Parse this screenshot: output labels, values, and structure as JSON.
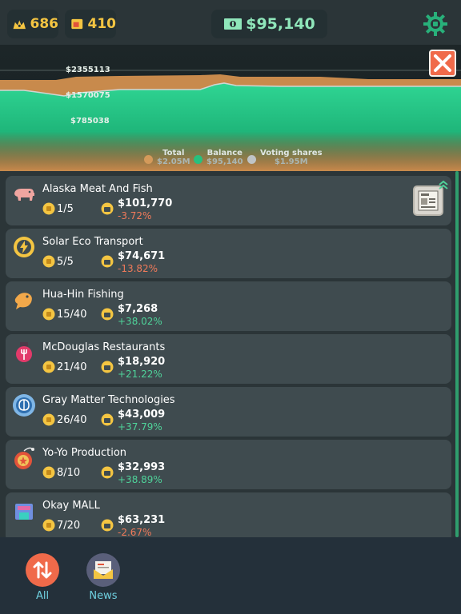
{
  "topbar": {
    "stat1": "686",
    "stat2": "410",
    "balance": "$95,140"
  },
  "chart_data": {
    "type": "area",
    "y_labels": [
      "$2355113",
      "$1570075",
      "$785038"
    ],
    "series": [
      {
        "name": "Total",
        "value": "$2.05M",
        "color": "#d49a5a"
      },
      {
        "name": "Balance",
        "value": "$95,140",
        "color": "#27c07e"
      },
      {
        "name": "Voting shares",
        "value": "$1.95M",
        "color": "#bfc4c6"
      }
    ]
  },
  "companies": [
    {
      "name": "Alaska Meat And Fish",
      "shares": "1/5",
      "price": "$101,770",
      "change": "-3.72%",
      "trend": "neg",
      "icon": "pig-icon",
      "news": true
    },
    {
      "name": "Solar Eco Transport",
      "shares": "5/5",
      "price": "$74,671",
      "change": "-13.82%",
      "trend": "neg",
      "icon": "lightning-icon"
    },
    {
      "name": "Hua-Hin Fishing",
      "shares": "15/40",
      "price": "$7,268",
      "change": "+38.02%",
      "trend": "pos",
      "icon": "fish-icon"
    },
    {
      "name": "McDouglas Restaurants",
      "shares": "21/40",
      "price": "$18,920",
      "change": "+21.22%",
      "trend": "pos",
      "icon": "fork-icon"
    },
    {
      "name": "Gray Matter Technologies",
      "shares": "26/40",
      "price": "$43,009",
      "change": "+37.79%",
      "trend": "pos",
      "icon": "brain-icon"
    },
    {
      "name": "Yo-Yo Production",
      "shares": "8/10",
      "price": "$32,993",
      "change": "+38.89%",
      "trend": "pos",
      "icon": "yoyo-icon"
    },
    {
      "name": "Okay MALL",
      "shares": "7/20",
      "price": "$63,231",
      "change": "-2.67%",
      "trend": "neg",
      "icon": "mall-icon"
    }
  ],
  "nav": {
    "all_label": "All",
    "news_label": "News"
  }
}
